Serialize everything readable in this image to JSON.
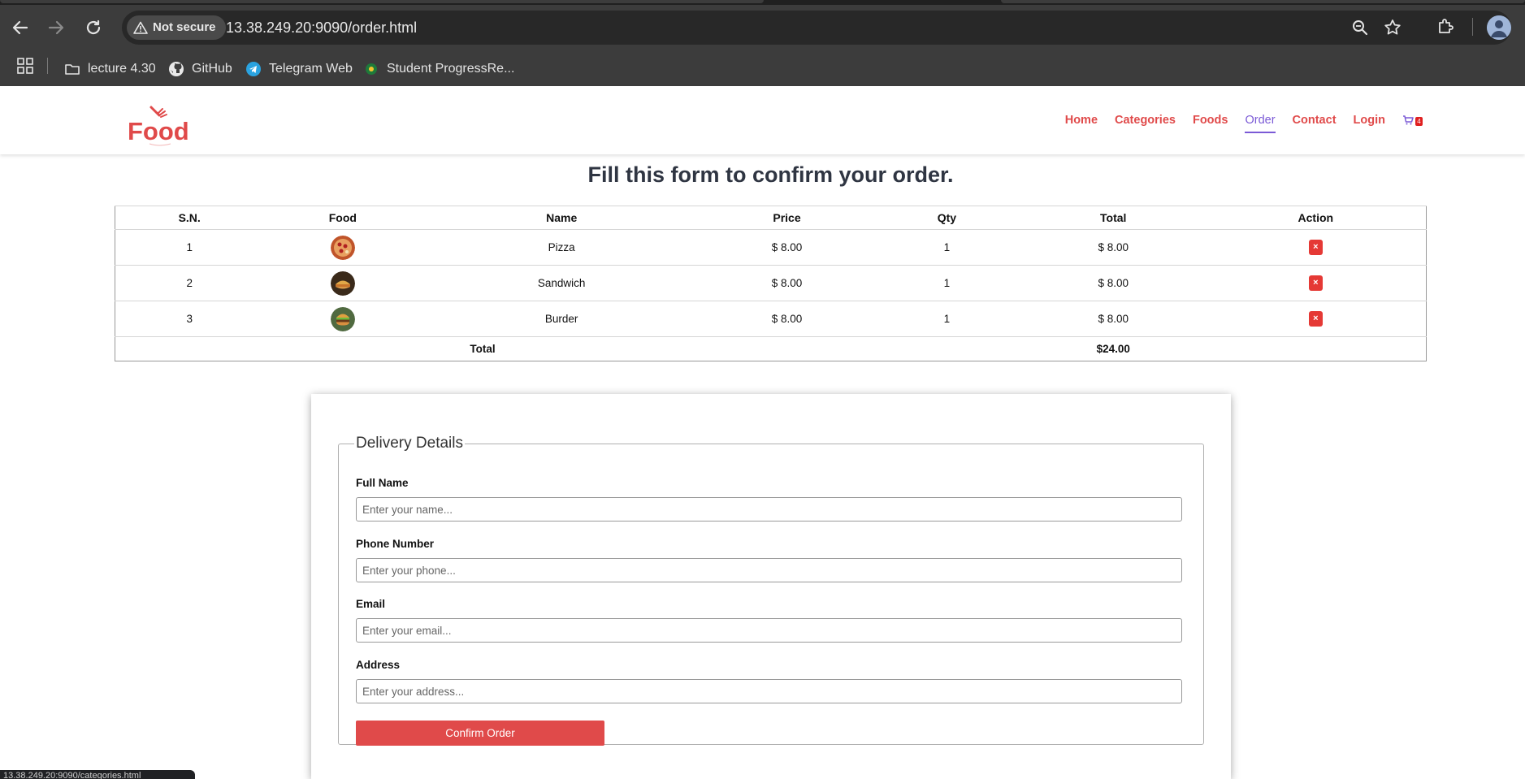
{
  "browser": {
    "security_label": "Not secure",
    "url": "13.38.249.20:9090/order.html",
    "bookmarks": [
      {
        "label": "lecture 4.30",
        "icon": "folder-icon"
      },
      {
        "label": "GitHub",
        "icon": "github-icon"
      },
      {
        "label": "Telegram Web",
        "icon": "telegram-icon"
      },
      {
        "label": "Student ProgressRe...",
        "icon": "student-progress-icon"
      }
    ],
    "status_url": "13.38.249.20:9090/categories.html"
  },
  "site": {
    "logo_text": "Food",
    "nav": [
      {
        "label": "Home",
        "active": false
      },
      {
        "label": "Categories",
        "active": false
      },
      {
        "label": "Foods",
        "active": false
      },
      {
        "label": "Order",
        "active": true
      },
      {
        "label": "Contact",
        "active": false
      },
      {
        "label": "Login",
        "active": false
      }
    ],
    "cart_count": "4",
    "colors": {
      "accent": "#e04a4a",
      "active": "#7b5ad6"
    }
  },
  "main": {
    "title": "Fill this form to confirm your order.",
    "table": {
      "headers": [
        "S.N.",
        "Food",
        "Name",
        "Price",
        "Qty",
        "Total",
        "Action"
      ],
      "rows": [
        {
          "sn": "1",
          "food_icon": "pizza-icon",
          "name": "Pizza",
          "price": "$ 8.00",
          "qty": "1",
          "total": "$ 8.00",
          "action": "×"
        },
        {
          "sn": "2",
          "food_icon": "sandwich-icon",
          "name": "Sandwich",
          "price": "$ 8.00",
          "qty": "1",
          "total": "$ 8.00",
          "action": "×"
        },
        {
          "sn": "3",
          "food_icon": "burger-icon",
          "name": "Burder",
          "price": "$ 8.00",
          "qty": "1",
          "total": "$ 8.00",
          "action": "×"
        }
      ],
      "total_label": "Total",
      "total_value": "$24.00"
    }
  },
  "form": {
    "legend": "Delivery Details",
    "fields": [
      {
        "label": "Full Name",
        "placeholder": "Enter your name...",
        "value": ""
      },
      {
        "label": "Phone Number",
        "placeholder": "Enter your phone...",
        "value": ""
      },
      {
        "label": "Email",
        "placeholder": "Enter your email...",
        "value": ""
      },
      {
        "label": "Address",
        "placeholder": "Enter your address...",
        "value": ""
      }
    ],
    "submit_label": "Confirm Order"
  }
}
